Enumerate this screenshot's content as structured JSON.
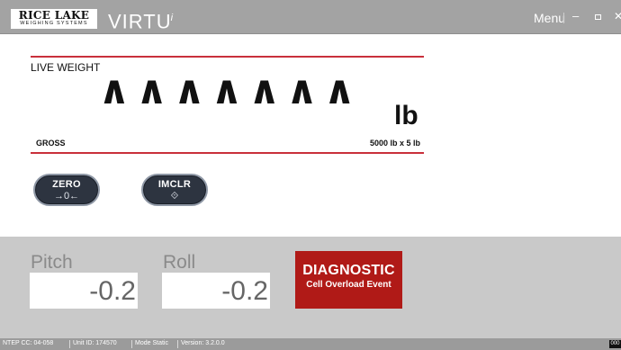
{
  "titlebar": {
    "brand_main": "RICE LAKE",
    "brand_sub": "WEIGHING SYSTEMS",
    "product": "VIRTU",
    "product_mark": "i",
    "menu_label": "Menu",
    "minimize_glyph": "–",
    "close_glyph": "✕"
  },
  "weight": {
    "label": "LIVE WEIGHT",
    "value": "∧∧∧∧∧∧∧",
    "unit": "lb",
    "mode": "GROSS",
    "capacity": "5000 lb x 5 lb"
  },
  "buttons": {
    "zero_label": "ZERO",
    "zero_glyph": "→0←",
    "imclr_label": "IMCLR",
    "imclr_glyph": "⟐"
  },
  "tilt": {
    "pitch_label": "Pitch",
    "pitch_value": "-0.2",
    "roll_label": "Roll",
    "roll_value": "-0.2"
  },
  "diagnostic": {
    "title": "DIAGNOSTIC",
    "message": "Cell Overload Event"
  },
  "status": {
    "ntep": "NTEP CC: 04-058",
    "unit_id": "Unit ID: 174570",
    "mode": "Mode Static",
    "version": "Version: 3.2.0.0",
    "tag": "000"
  },
  "colors": {
    "accent_red": "#c9303b",
    "diagnostic_red": "#b01a17",
    "titlebar_grey": "#a3a3a3",
    "panel_grey": "#c9c9c9",
    "button_dark": "#2d3440"
  }
}
